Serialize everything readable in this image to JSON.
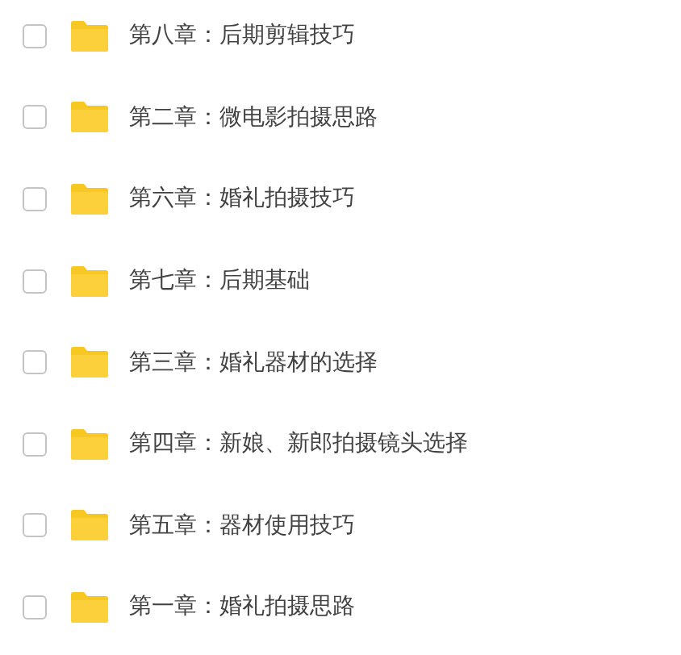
{
  "folders": [
    {
      "name": "第八章：后期剪辑技巧",
      "checked": false
    },
    {
      "name": "第二章：微电影拍摄思路",
      "checked": false
    },
    {
      "name": "第六章：婚礼拍摄技巧",
      "checked": false
    },
    {
      "name": "第七章：后期基础",
      "checked": false
    },
    {
      "name": "第三章：婚礼器材的选择",
      "checked": false
    },
    {
      "name": "第四章：新娘、新郎拍摄镜头选择",
      "checked": false
    },
    {
      "name": "第五章：器材使用技巧",
      "checked": false
    },
    {
      "name": "第一章：婚礼拍摄思路",
      "checked": false
    }
  ]
}
